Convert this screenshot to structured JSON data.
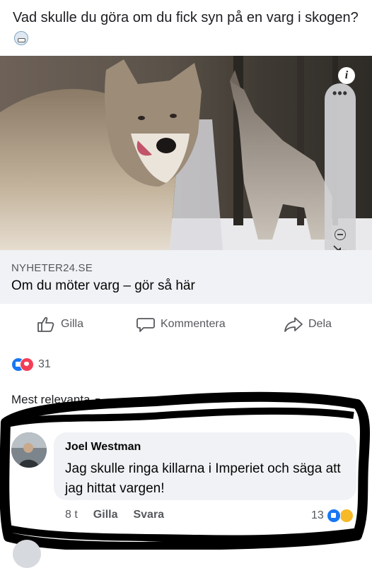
{
  "post": {
    "text": "Vad skulle du göra om du fick syn på en varg i skogen?"
  },
  "link_preview": {
    "source": "NYHETER24.SE",
    "title": "Om du möter varg – gör så här"
  },
  "video_controls": {
    "info_label": "i",
    "more_label": "•••"
  },
  "actions": {
    "like_label": "Gilla",
    "comment_label": "Kommentera",
    "share_label": "Dela"
  },
  "reactions": {
    "count": "31"
  },
  "comments_sort": {
    "label": "Mest relevanta"
  },
  "comment": {
    "author": "Joel Westman",
    "text": "Jag skulle ringa killarna i Imperiet och säga att jag hittat vargen!",
    "time": "8 t",
    "like_label": "Gilla",
    "reply_label": "Svara",
    "reaction_count": "13"
  },
  "colors": {
    "like_blue": "#1877f2",
    "love_red": "#f33e58",
    "haha_yellow": "#f7b928",
    "card_bg": "#f0f2f5",
    "scribble": "#000000"
  },
  "icons": {
    "like": "thumbs-up-icon",
    "comment": "speech-bubble-icon",
    "share": "share-arrow-icon",
    "mute": "speaker-muted-icon",
    "sort": "chevron-down-icon"
  }
}
